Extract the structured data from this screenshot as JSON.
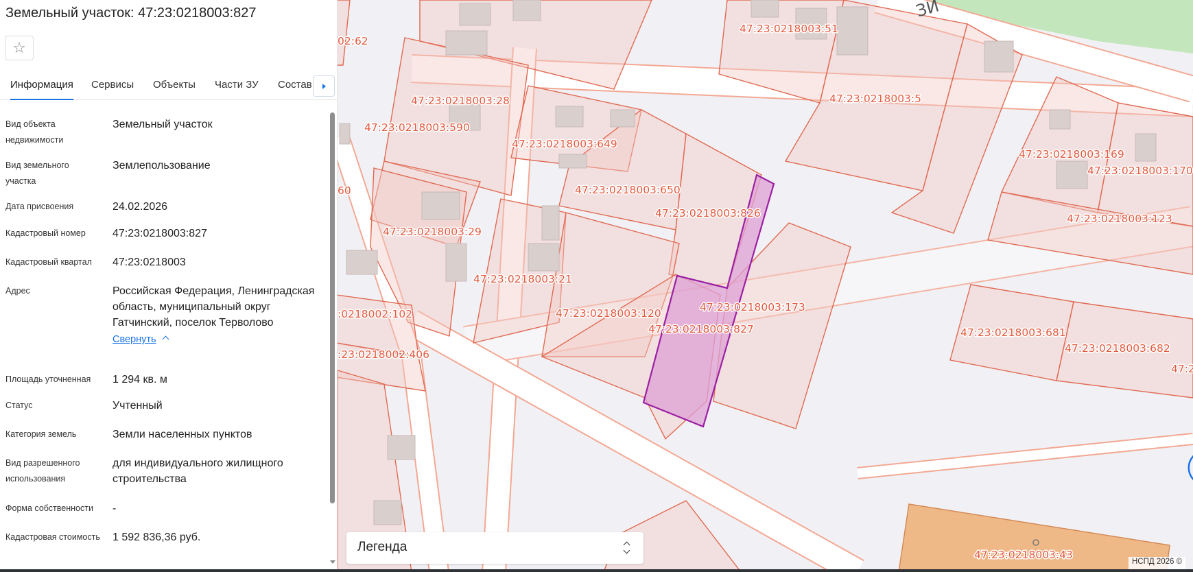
{
  "panel": {
    "title": "Земельный участок: 47:23:0218003:827",
    "favorite_icon": "star-outline-icon",
    "tabs": [
      "Информация",
      "Сервисы",
      "Объекты",
      "Части ЗУ",
      "Состав"
    ],
    "active_tab": "Информация",
    "properties": [
      {
        "label": "Вид объекта недвижимости",
        "value": "Земельный участок"
      },
      {
        "label": "Вид земельного участка",
        "value": "Землепользование"
      },
      {
        "label": "Дата присвоения",
        "value": "24.02.2026"
      },
      {
        "label": "Кадастровый номер",
        "value": "47:23:0218003:827"
      },
      {
        "label": "Кадастровый квартал",
        "value": "47:23:0218003"
      },
      {
        "label": "Адрес",
        "value": "Российская Федерация, Ленинградская область, муниципальный округ Гатчинский, поселок Терволово"
      },
      {
        "label": "Площадь уточненная",
        "value": "1 294 кв. м"
      },
      {
        "label": "Статус",
        "value": "Учтенный"
      },
      {
        "label": "Категория земель",
        "value": "Земли населенных пунктов"
      },
      {
        "label": "Вид разрешенного использования",
        "value": "для индивидуального жилищного строительства"
      },
      {
        "label": "Форма собственности",
        "value": "-"
      },
      {
        "label": "Кадастровая стоимость",
        "value": "1 592 836,36 руб."
      }
    ],
    "collapse_link": "Свернуть"
  },
  "map": {
    "street_label_fragment": "ЗЙ",
    "selected_parcel": "47:23:0218003:827",
    "parcel_labels": [
      "47:23:0218003:51",
      "02:62",
      "47:23:0218003:28",
      "47:23:0218003:590",
      "47:23:0218003:649",
      "47:23:0218003:5",
      "47:23:0218003:169",
      "47:23:0218003:170",
      "47:23:0218003:650",
      "47:23:0218003:826",
      "47:23:0218003:123",
      "60",
      "47:23:0218003:29",
      "47:23:0218003:21",
      "47:23:0218003:173",
      "47:23:0218003:120",
      "47:23:0218003:827",
      ":0218002:102",
      "47:23:0218003:681",
      "47:23:0218003:682",
      "47:2",
      ":23:0218002:406",
      "47:23:0218003:43"
    ],
    "colors": {
      "parcel_stroke": "#e06a52",
      "selected_stroke": "#9b1fa3",
      "selected_fill": "#dea0d4",
      "accent": "#1a73e8"
    }
  },
  "legend": {
    "label": "Легенда",
    "toggle_icon": "chevron-up-down-icon"
  },
  "attribution": "НСПД 2026 ©"
}
